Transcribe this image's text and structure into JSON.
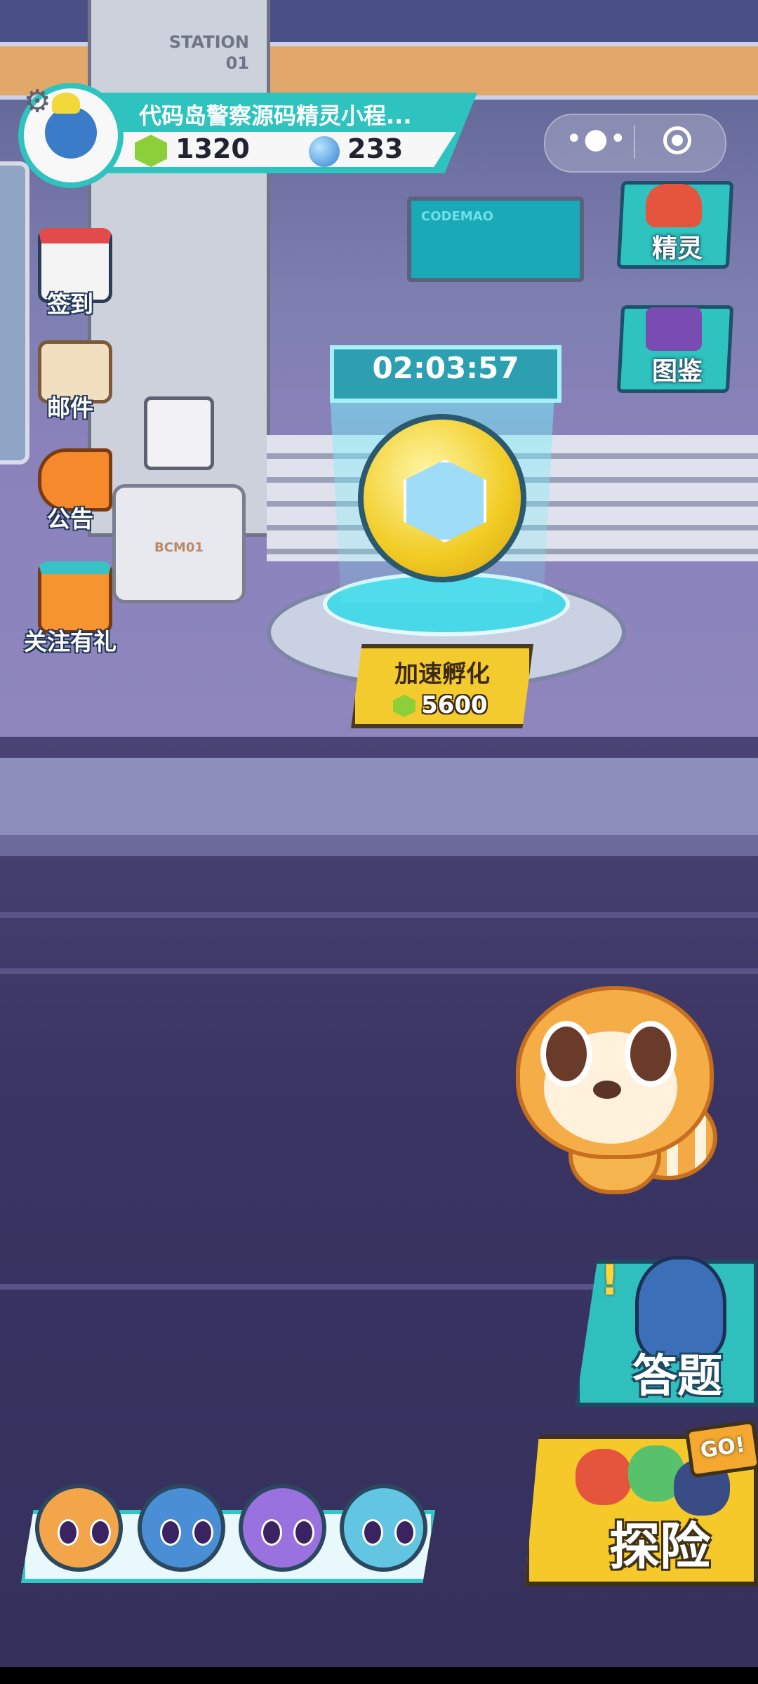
{
  "player": {
    "name": "代码岛警察源码精灵小程...",
    "gems": "1320",
    "orbs": "233"
  },
  "scene": {
    "station_label": "STATION\n01",
    "console_label": "CODEMAO",
    "machine_label": "BCM01"
  },
  "left_menu": [
    {
      "label": "签到",
      "icon": "calendar-icon"
    },
    {
      "label": "邮件",
      "icon": "mail-icon"
    },
    {
      "label": "公告",
      "icon": "megaphone-icon"
    },
    {
      "label": "关注有礼",
      "icon": "gift-icon"
    }
  ],
  "right_nav": [
    {
      "label": "精灵",
      "icon": "fox-sprite-icon"
    },
    {
      "label": "图鉴",
      "icon": "book-icon"
    }
  ],
  "incubator": {
    "timer": "02:03:57",
    "speed_label": "加速孵化",
    "speed_cost": "5600"
  },
  "actions": {
    "quiz_label": "答题",
    "quiz_alert": "!",
    "adventure_label": "探险",
    "adventure_badge": "GO!"
  },
  "party": [
    {
      "name": "raccoon",
      "color": "#f3a54a"
    },
    {
      "name": "blue-knight",
      "color": "#4a8fd6"
    },
    {
      "name": "purple-sprite",
      "color": "#9a72e0"
    },
    {
      "name": "orange-helmet",
      "color": "#62c6e2"
    }
  ],
  "colors": {
    "accent": "#2ec3bf",
    "gold": "#f4cb2e",
    "gem": "#8ccf3a"
  }
}
